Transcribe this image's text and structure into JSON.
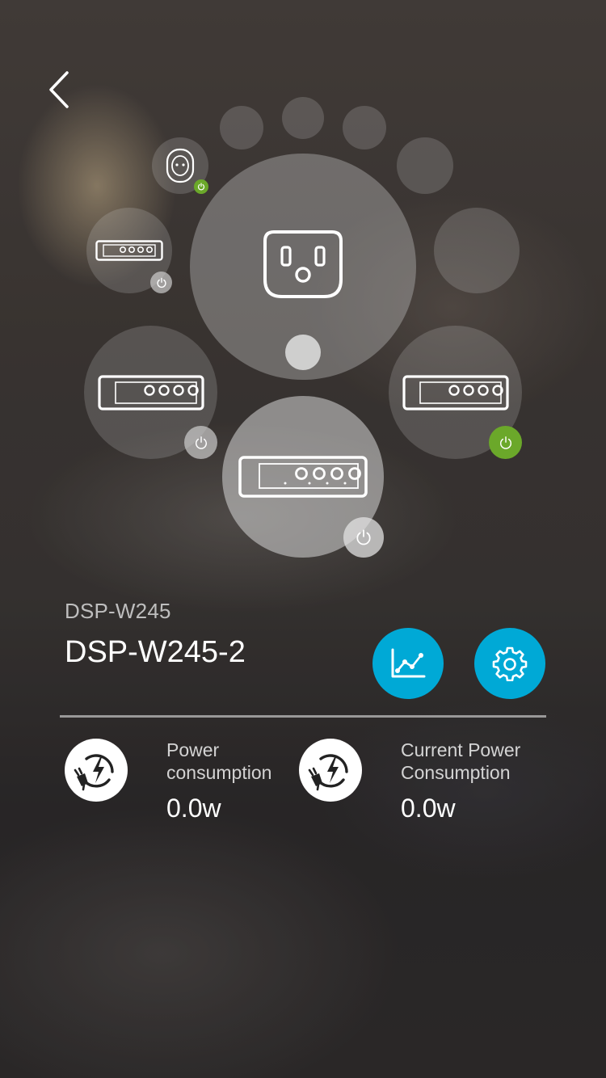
{
  "nav": {
    "back_icon": "chevron-left-icon"
  },
  "device": {
    "model": "DSP-W245",
    "name": "DSP-W245-2"
  },
  "devices": [
    {
      "id": "main-outlet",
      "icon": "us-outlet-icon",
      "selected": true
    },
    {
      "id": "smart-plug",
      "icon": "round-plug-icon",
      "power": "on"
    },
    {
      "id": "strip-small",
      "icon": "power-strip-icon",
      "power": "off"
    },
    {
      "id": "strip-left",
      "icon": "power-strip-icon",
      "power": "off"
    },
    {
      "id": "strip-center",
      "icon": "power-strip-icon",
      "power": "off",
      "active": true
    },
    {
      "id": "strip-right",
      "icon": "power-strip-icon",
      "power": "on"
    }
  ],
  "actions": {
    "chart_icon": "line-chart-icon",
    "settings_icon": "gear-icon"
  },
  "stats": {
    "power_consumption": {
      "label_line1": "Power",
      "label_line2": "consumption",
      "value": "0.0w",
      "icon": "power-plug-icon"
    },
    "current_power_consumption": {
      "label_line1": "Current Power",
      "label_line2": "Consumption",
      "value": "0.0w",
      "icon": "power-plug-icon"
    }
  },
  "colors": {
    "accent": "#00a9d6",
    "power_on": "#6ba82a",
    "text_primary": "#ffffff"
  }
}
